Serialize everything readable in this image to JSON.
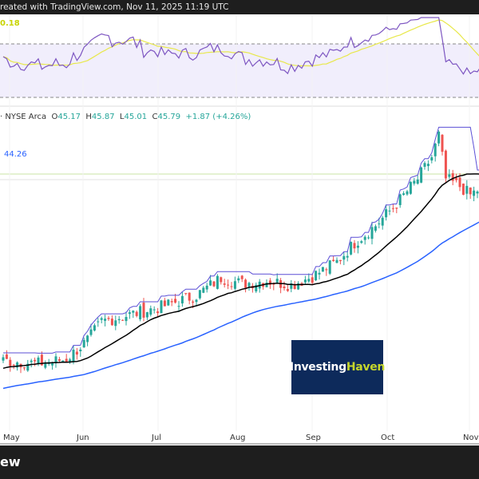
{
  "header": {
    "text": "reated with TradingView.com, Nov 11, 2025 11:19 UTC"
  },
  "rsi": {
    "value_label": "0.18"
  },
  "legend": {
    "exchange": "· NYSE Arca",
    "open_label": "O",
    "open": "45.17",
    "high_label": "H",
    "high": "45.87",
    "low_label": "L",
    "low": "45.01",
    "close_label": "C",
    "close": "45.79",
    "change": "+1.87 (+4.26%)"
  },
  "price_label": "44.26",
  "watermark": {
    "part1": "Investing",
    "part2": "Haven"
  },
  "x_axis": [
    "May",
    "Jun",
    "Jul",
    "Aug",
    "Sep",
    "Oct",
    "Nov"
  ],
  "footer": {
    "brand": "ew"
  },
  "colors": {
    "up": "#26a69a",
    "down": "#ef5350",
    "sma_fast": "#000000",
    "sma_slow": "#2962ff",
    "upper_band": "#5b4fd6",
    "rsi": "#7e57c2"
  },
  "chart_data": {
    "type": "candlestick",
    "key_closes": [
      [
        -50,
        27.5
      ],
      [
        0,
        30.1
      ],
      [
        10,
        29.9
      ],
      [
        18,
        30.2
      ],
      [
        24,
        31.5
      ],
      [
        28,
        32.8
      ],
      [
        35,
        33.2
      ],
      [
        45,
        33.8
      ],
      [
        55,
        34.6
      ],
      [
        62,
        35.8
      ],
      [
        68,
        35.4
      ],
      [
        75,
        35.6
      ],
      [
        82,
        35.3
      ],
      [
        88,
        35.9
      ],
      [
        95,
        36.9
      ],
      [
        100,
        38.2
      ],
      [
        106,
        39.4
      ],
      [
        112,
        40.9
      ],
      [
        118,
        42.6
      ],
      [
        122,
        44.1
      ],
      [
        124,
        45.6
      ],
      [
        126,
        42.6
      ],
      [
        130,
        42.1
      ],
      [
        133,
        41.5
      ],
      [
        136,
        42.0
      ]
    ],
    "x_ticks": [
      "May",
      "Jun",
      "Jul",
      "Aug",
      "Sep",
      "Oct",
      "Nov"
    ]
  }
}
